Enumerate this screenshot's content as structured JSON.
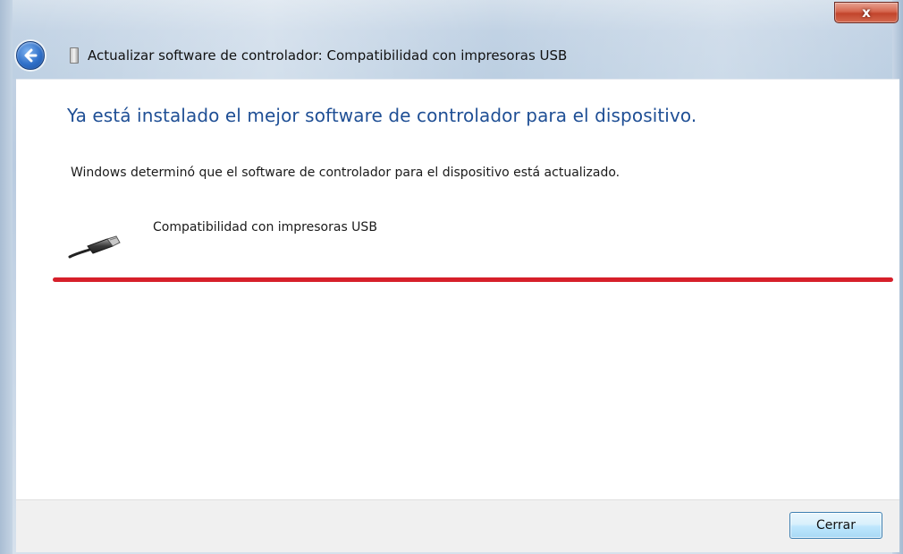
{
  "window": {
    "title": "Actualizar software de controlador: Compatibilidad con impresoras USB",
    "close_glyph": "x",
    "accent_color": "#1f4f95",
    "close_color": "#c2442c"
  },
  "main": {
    "heading": "Ya está instalado el mejor software de controlador para el dispositivo.",
    "description": "Windows determinó que el software de controlador para el dispositivo está actualizado.",
    "device_name": "Compatibilidad con impresoras USB",
    "device_icon": "usb-cable-icon",
    "highlight_color": "#d61f2a"
  },
  "footer": {
    "close_label": "Cerrar"
  },
  "icons": {
    "back": "back-arrow-icon",
    "title_device": "device-icon"
  }
}
